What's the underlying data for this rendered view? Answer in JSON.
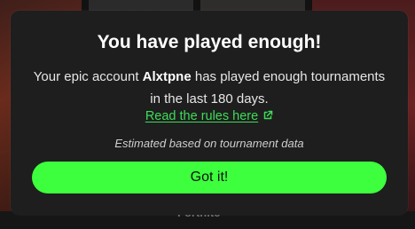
{
  "modal": {
    "title": "You have played enough!",
    "body_prefix": "Your epic account ",
    "account_name": "Alxtpne",
    "body_suffix": " has played enough tournaments in the last 180 days.",
    "rules_link_label": "Read the rules here",
    "rules_link_icon": "external-link-icon",
    "estimate_note": "Estimated based on tournament data",
    "confirm_label": "Got it!"
  },
  "background": {
    "card_caption": "Fortnite"
  },
  "colors": {
    "modal_bg": "#1e1e1e",
    "accent_green": "#3dff3d",
    "link_green": "#3ddc58"
  }
}
